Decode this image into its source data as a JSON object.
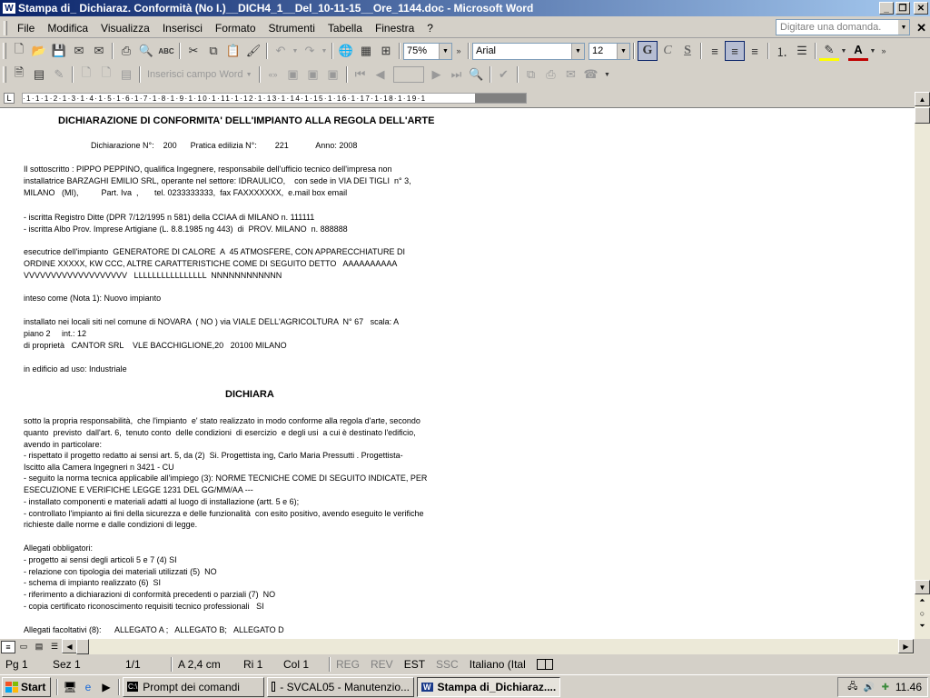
{
  "window": {
    "title": "Stampa di_ Dichiaraz. Conformità (No I.)__DICH4_1__Del_10-11-15__Ore_1144.doc - Microsoft Word",
    "app_icon": "W"
  },
  "menu": {
    "items": [
      "File",
      "Modifica",
      "Visualizza",
      "Inserisci",
      "Formato",
      "Strumenti",
      "Tabella",
      "Finestra",
      "?"
    ],
    "help_placeholder": "Digitare una domanda."
  },
  "toolbar": {
    "zoom": "75%",
    "font": "Arial",
    "size": "12",
    "bold": "G",
    "italic": "C",
    "underline": "S",
    "insert_field": "Inserisci campo Word"
  },
  "ruler": {
    "ticks": "·1·1·1·2·1·3·1·4·1·5·1·6·1·7·1·8·1·9·1·10·1·11·1·12·1·13·1·14·1·15·1·16·1·17·1·18·1·19·1"
  },
  "document": {
    "heading": "DICHIARAZIONE DI CONFORMITA' DELL'IMPIANTO ALLA REGOLA DELL'ARTE",
    "numbers_line": "Dichiarazione N°:    200      Pratica edilizia N°:        221            Anno: 2008",
    "p1": [
      "Il sottoscritto : PIPPO PEPPINO, qualifica Ingegnere, responsabile dell'ufficio tecnico dell'impresa non",
      "installatrice BARZAGHI EMILIO SRL, operante nel settore: IDRAULICO,    con sede in VIA DEI TIGLI  n° 3,",
      "MILANO   (MI),          Part. Iva  ,       tel. 0233333333,  fax FAXXXXXXX,  e.mail box email"
    ],
    "p2": [
      "- iscritta Registro Ditte (DPR 7/12/1995 n 581) della CCIAA di MILANO n. 111111",
      "- iscritta Albo Prov. Imprese Artigiane (L. 8.8.1985 ng 443)  di  PROV. MILANO  n. 888888"
    ],
    "p3": [
      "esecutrice dell'impianto  GENERATORE DI CALORE  A  45 ATMOSFERE, CON APPARECCHIATURE DI",
      "ORDINE XXXXX, KW CCC, ALTRE CARATTERISTICHE COME DI SEGUITO DETTO   AAAAAAAAAA",
      "VVVVVVVVVVVVVVVVVVV   LLLLLLLLLLLLLLLL  NNNNNNNNNNNN"
    ],
    "p4": "inteso come (Nota 1): Nuovo impianto",
    "p5": [
      "installato nei locali siti nel comune di NOVARA  ( NO ) via VIALE DELL'AGRICOLTURA  N° 67   scala: A",
      "piano 2     int.: 12",
      "di proprietà   CANTOR SRL    VLE BACCHIGLIONE,20   20100 MILANO"
    ],
    "p6": "in edificio ad uso: Industriale",
    "dichiara": "DICHIARA",
    "p7": [
      "sotto la propria responsabilità,  che l'impianto  e' stato realizzato in modo conforme alla regola d'arte, secondo",
      "quanto  previsto  dall'art. 6,  tenuto conto  delle condizioni  di esercizio  e degli usi  a cui è destinato l'edificio,",
      "avendo in particolare:",
      "- rispettato il progetto redatto ai sensi art. 5, da (2)  Si. Progettista ing, Carlo Maria Pressutti . Progettista-",
      "Iscitto alla Camera Ingegneri n 3421 - CU",
      "- seguito la norma tecnica applicabile all'impiego (3): NORME TECNICHE COME DI SEGUITO INDICATE, PER",
      "ESECUZIONE E VERIFICHE LEGGE 1231 DEL GG/MM/AA ---",
      "- installato componenti e materiali adatti al luogo di installazione (artt. 5 e 6);",
      "- controllato l'impianto ai fini della sicurezza e delle funzionalità  con esito positivo, avendo eseguito le verifiche",
      "richieste dalle norme e dalle condizioni di legge."
    ],
    "p8": [
      "Allegati obbligatori:",
      "- progetto ai sensi degli articoli 5 e 7 (4) SI",
      "- relazione con tipologia dei materiali utilizzati (5)  NO",
      "- schema di impianto realizzato (6)  SI",
      "- riferimento a dichiarazioni di conformità precedenti o parziali (7)  NO",
      "- copia certificato riconoscimento requisiti tecnico professionali   SI"
    ],
    "p9": "Allegati facoltativi (8):      ALLEGATO A ;   ALLEGATO B;   ALLEGATO D"
  },
  "status": {
    "page": "Pg 1",
    "section": "Sez 1",
    "pages": "1/1",
    "position": "A  2,4 cm",
    "line": "Ri 1",
    "column": "Col 1",
    "reg": "REG",
    "rev": "REV",
    "est": "EST",
    "ssc": "SSC",
    "language": "Italiano (Ital"
  },
  "taskbar": {
    "start": "Start",
    "tasks": [
      "Prompt dei comandi",
      "- SVCAL05 - Manutenzio...",
      "Stampa di_Dichiaraz...."
    ],
    "clock": "11.46"
  },
  "colors": {
    "titlebar_start": "#0a246a",
    "titlebar_end": "#a6caf0",
    "chrome": "#d4d0c8"
  }
}
